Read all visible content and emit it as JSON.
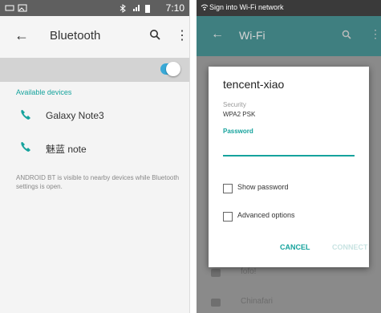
{
  "left": {
    "status_time": "7:10",
    "toolbar": {
      "title": "Bluetooth"
    },
    "bluetooth_enabled": true,
    "section_label": "Available devices",
    "devices": [
      {
        "name": "Galaxy Note3",
        "icon": "phone-icon"
      },
      {
        "name": "魅蓝 note",
        "icon": "phone-icon"
      }
    ],
    "info_text": "ANDROID BT is visible to nearby devices while Bluetooth settings is open."
  },
  "right": {
    "status_text": "Sign into Wi-Fi network",
    "toolbar": {
      "title": "Wi-Fi"
    },
    "background_rows": [
      {
        "label": "fofo!"
      },
      {
        "label": "Chinafari"
      }
    ],
    "dialog": {
      "title": "tencent-xiao",
      "security_label": "Security",
      "security_value": "WPA2 PSK",
      "password_label": "Password",
      "password_value": "",
      "show_password_label": "Show password",
      "advanced_options_label": "Advanced options",
      "show_password_checked": false,
      "advanced_options_checked": false,
      "cancel_label": "CANCEL",
      "connect_label": "CONNECT"
    }
  },
  "colors": {
    "accent": "#16a39d",
    "toggle": "#39a9d7"
  }
}
